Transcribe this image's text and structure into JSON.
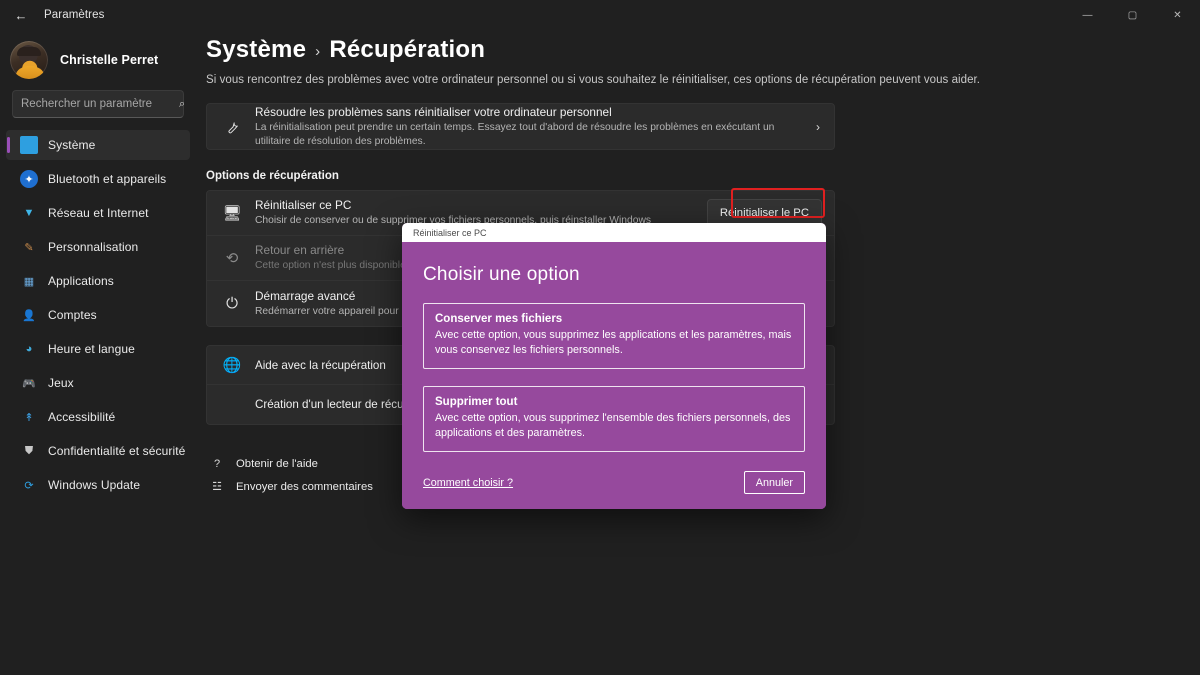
{
  "colors": {
    "accent": "#9a4fb8",
    "dialog_purple": "#96499d",
    "highlight_red": "#e02020",
    "page_bg": "#202020",
    "card_bg": "#2b2b2b"
  },
  "titlebar": {
    "back_glyph": "←",
    "title": "Paramètres",
    "minimize_glyph": "—",
    "maximize_glyph": "▢",
    "close_glyph": "✕"
  },
  "sidebar": {
    "profile_name": "Christelle Perret",
    "search": {
      "placeholder": "Rechercher un paramètre",
      "value": "",
      "icon_glyph": "⌕"
    },
    "items": [
      {
        "label": "Système",
        "icon": "display-icon",
        "glyph": "",
        "cls": "ic-system",
        "active": true
      },
      {
        "label": "Bluetooth et appareils",
        "icon": "bluetooth-icon",
        "glyph": "✦",
        "cls": "ic-bt",
        "active": false
      },
      {
        "label": "Réseau et Internet",
        "icon": "wifi-icon",
        "glyph": "▼",
        "cls": "ic-net",
        "active": false
      },
      {
        "label": "Personnalisation",
        "icon": "paintbrush-icon",
        "glyph": "✎",
        "cls": "ic-perso",
        "active": false
      },
      {
        "label": "Applications",
        "icon": "apps-grid-icon",
        "glyph": "▦",
        "cls": "ic-apps",
        "active": false
      },
      {
        "label": "Comptes",
        "icon": "person-icon",
        "glyph": "👤",
        "cls": "ic-accounts",
        "active": false
      },
      {
        "label": "Heure et langue",
        "icon": "clock-icon",
        "glyph": "◕",
        "cls": "ic-time",
        "active": false
      },
      {
        "label": "Jeux",
        "icon": "gamepad-icon",
        "glyph": "🎮",
        "cls": "ic-games",
        "active": false
      },
      {
        "label": "Accessibilité",
        "icon": "accessibility-icon",
        "glyph": "↟",
        "cls": "ic-access",
        "active": false
      },
      {
        "label": "Confidentialité et sécurité",
        "icon": "shield-icon",
        "glyph": "⛊",
        "cls": "ic-privacy",
        "active": false
      },
      {
        "label": "Windows Update",
        "icon": "refresh-icon",
        "glyph": "⟳",
        "cls": "ic-update",
        "active": false
      }
    ]
  },
  "page": {
    "breadcrumb_root": "Système",
    "breadcrumb_separator": "›",
    "breadcrumb_current": "Récupération",
    "description": "Si vous rencontrez des problèmes avec votre ordinateur personnel ou si vous souhaitez le réinitialiser, ces options de récupération peuvent vous aider.",
    "troubleshoot_card": {
      "icon": "wrench-icon",
      "icon_glyph": "🔧",
      "title": "Résoudre les problèmes sans réinitialiser votre ordinateur personnel",
      "description": "La réinitialisation peut prendre un certain temps. Essayez tout d'abord de résoudre les problèmes en exécutant un utilitaire de résolution des problèmes.",
      "chevron_glyph": "›"
    },
    "section_title": "Options de récupération",
    "recovery_rows": [
      {
        "icon": "pc-reset-icon",
        "icon_glyph": "🖥",
        "title": "Réinitialiser ce PC",
        "description": "Choisir de conserver ou de supprimer vos fichiers personnels, puis réinstaller Windows",
        "button_label": "Réinitialiser le PC",
        "disabled": false,
        "highlighted": true
      },
      {
        "icon": "history-back-icon",
        "icon_glyph": "⟲",
        "title": "Retour en arrière",
        "description": "Cette option n'est plus disponible sur cet ordinateur",
        "button_label": "",
        "disabled": true,
        "highlighted": false
      },
      {
        "icon": "power-advanced-icon",
        "icon_glyph": "⏻",
        "title": "Démarrage avancé",
        "description": "Redémarrer votre appareil pour modifier les paramètres de démarrage",
        "button_label": "",
        "disabled": false,
        "highlighted": false
      }
    ],
    "help_rows": [
      {
        "icon": "globe-icon",
        "icon_glyph": "🌐",
        "title": "Aide avec la récupération",
        "indent": false
      },
      {
        "icon": "",
        "icon_glyph": "",
        "title": "Création d'un lecteur de récupération",
        "indent": true
      }
    ],
    "footer_links": [
      {
        "icon": "help-question-icon",
        "icon_glyph": "?",
        "label": "Obtenir de l'aide"
      },
      {
        "icon": "feedback-icon",
        "icon_glyph": "☳",
        "label": "Envoyer des commentaires"
      }
    ]
  },
  "dialog": {
    "window_title": "Réinitialiser ce PC",
    "heading": "Choisir une option",
    "options": [
      {
        "title": "Conserver mes fichiers",
        "description": "Avec cette option, vous supprimez les applications et les paramètres, mais vous conservez les fichiers personnels."
      },
      {
        "title": "Supprimer tout",
        "description": "Avec cette option, vous supprimez l'ensemble des fichiers personnels, des applications et des paramètres."
      }
    ],
    "help_link": "Comment choisir ?",
    "cancel_label": "Annuler"
  }
}
